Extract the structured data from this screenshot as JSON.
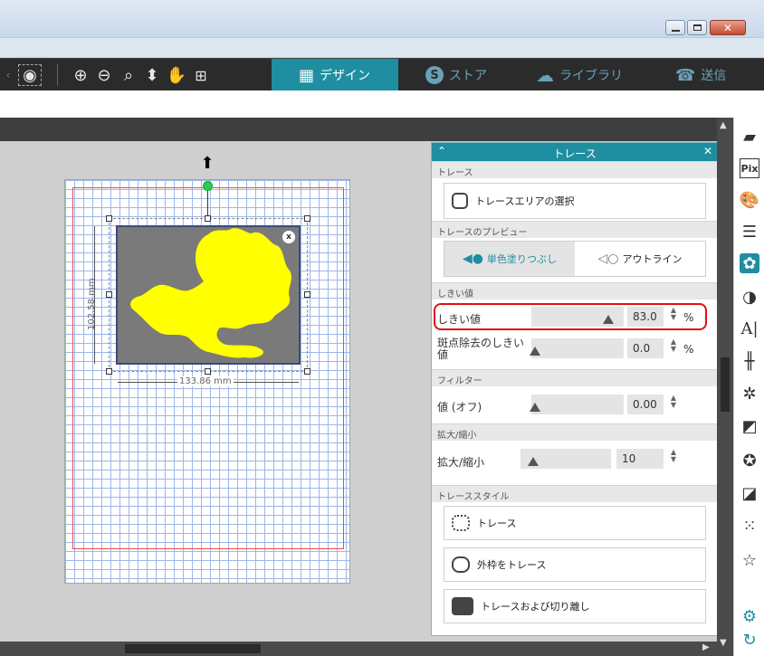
{
  "toolbar": {
    "tabs": [
      {
        "label": "デザイン",
        "active": true
      },
      {
        "label": "ストア",
        "active": false
      },
      {
        "label": "ライブラリ",
        "active": false
      },
      {
        "label": "送信",
        "active": false
      }
    ]
  },
  "canvas": {
    "width_dim": "133.86 mm",
    "height_dim": "102.58 mm",
    "image_color": "#ffff00"
  },
  "trace_panel": {
    "title": "トレース",
    "sections": {
      "trace": "トレース",
      "preview": "トレースのプレビュー",
      "threshold": "しきい値",
      "filter": "フィルター",
      "scale": "拡大/縮小",
      "trace_style": "トレーススタイル"
    },
    "select_area_label": "トレースエリアの選択",
    "preview_fill_label": "単色塗りつぶし",
    "preview_outline_label": "アウトライン",
    "threshold_label": "しきい値",
    "threshold_value": "83.0",
    "threshold_unit": "%",
    "threshold_level": 0.83,
    "speck_label_1": "斑点除去のしきい",
    "speck_label_2": "値",
    "speck_value": "0.0",
    "speck_unit": "%",
    "filter_label": "値 (オフ)",
    "filter_value": "0.00",
    "scale_label": "拡大/縮小",
    "scale_value": "10",
    "style_trace": "トレース",
    "style_outer": "外枠をトレース",
    "style_detach": "トレースおよび切り離し"
  },
  "right_panel": {
    "pix_label": "Pix",
    "text_label": "A|"
  }
}
